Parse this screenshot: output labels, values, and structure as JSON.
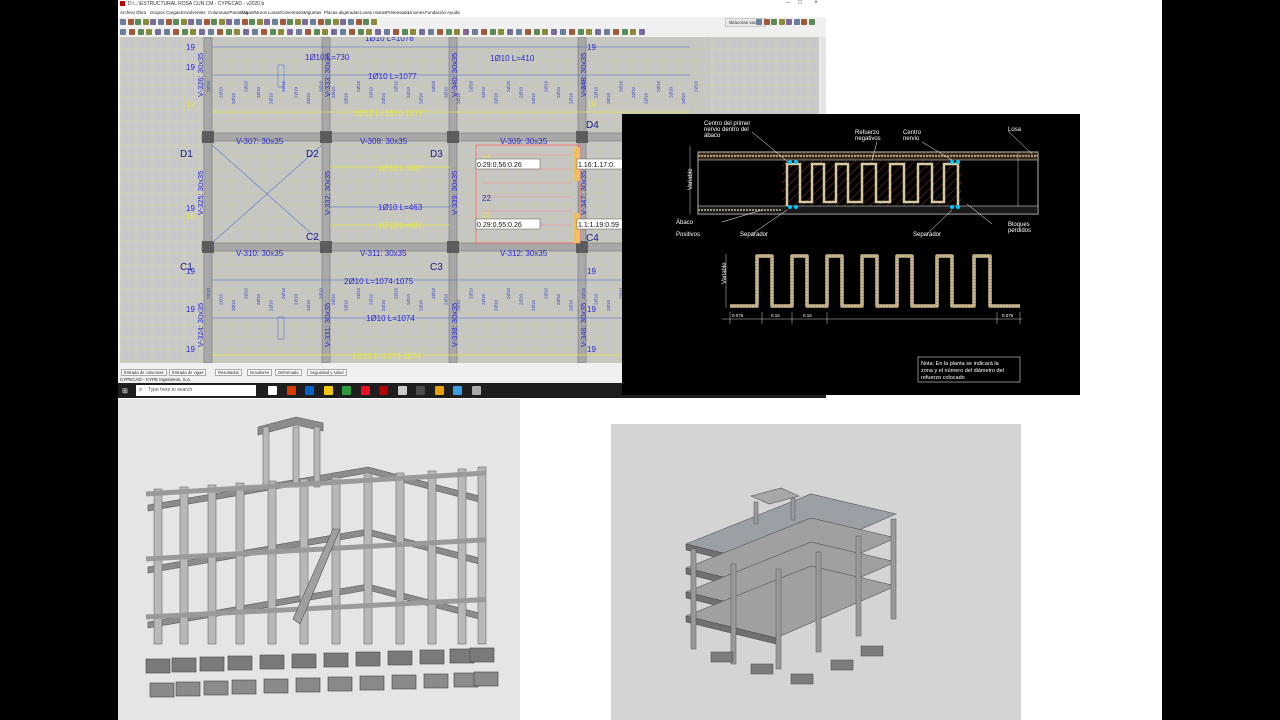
{
  "window": {
    "title": "D:\\...\\ESTRUCTURAL ROSA CUN.CM - CYPECAD - v2020.b",
    "controls": [
      "–",
      "□",
      "×"
    ]
  },
  "menu": [
    "Archivo",
    "Obra",
    "Grupos",
    "Cargas",
    "Envolventes",
    "Columnas/Pantallas",
    "Vigas/Muros",
    "Losas/Cimentados",
    "Viguetas",
    "Placas aligeradas",
    "Losas mixtas",
    "Pretensado",
    "Uniones",
    "Fundación",
    "Ayuda"
  ],
  "toolbar": {
    "badge": "Bitácoras vacias"
  },
  "plan": {
    "beams": [
      {
        "label": "V-307: 30x35"
      },
      {
        "label": "V-308: 30x35"
      },
      {
        "label": "V-309: 30x35"
      },
      {
        "label": "V-310: 30x35"
      },
      {
        "label": "V-311: 30x35"
      },
      {
        "label": "V-312: 30x35"
      }
    ],
    "vbeams": [
      "V-326: 30x35",
      "V-333: 30x35",
      "V-340: 30x35",
      "V-348: 30x35",
      "V-325: 30x35",
      "V-332: 30x35",
      "V-339: 30x35",
      "V-347: 30x35",
      "V-324: 30x35",
      "V-331: 30x35",
      "V-338: 30x35",
      "V-346: 30x35"
    ],
    "nodes": [
      "D1",
      "D2",
      "D3",
      "D4",
      "C1",
      "C2",
      "C3",
      "C4"
    ],
    "rebar_blue": [
      "1Ø10 L=1076",
      "1Ø10 L=730",
      "1Ø10 L=1077",
      "1Ø10 L=410",
      "1Ø10 L=463",
      "2Ø10 L=1074-1075",
      "1Ø10 L=1074"
    ],
    "rebar_yellow": [
      "1Ø12 L=1076-1077",
      "1Ø12 L=407",
      "1Ø12 L=407",
      "1Ø12 L=1073-1074"
    ],
    "side_numbers": [
      "19",
      "19",
      "19",
      "19",
      "19",
      "19",
      "19",
      "19",
      "19",
      "19",
      "19",
      "19",
      "19",
      "19"
    ],
    "stair_numbers": [
      "22",
      "22",
      "22"
    ],
    "values": [
      "0.29:0.56:0.26",
      "1.16:1.17:0.",
      "0.29:0.55:0.26",
      "1.1:1.19:0.59"
    ]
  },
  "tabs": [
    "Entrada de columnas",
    "Entrada de vigas",
    "Resultados",
    "Isovalores",
    "Deformada",
    "Seguridad y salud"
  ],
  "status": "CYPECAD - CYPE Ingenieros, S.A.",
  "taskbar": {
    "search_placeholder": "Type here to search",
    "app_colors": [
      "#ffffff",
      "#d83b01",
      "#0a64c8",
      "#f2c811",
      "#2a9d3a",
      "#e81123",
      "#b00000",
      "#cccccc",
      "#4c4c4c",
      "#e8a000",
      "#3a9de0",
      "#aaaaaa"
    ]
  },
  "cad_detail": {
    "labels": [
      "Centro del primer",
      "nervio dentro del",
      "ábaco",
      "Refuerzo",
      "negativos",
      "Centro",
      "nervio",
      "Losa",
      "Ábaco",
      "Positivos",
      "Separador",
      "Separador",
      "Bloques",
      "perdidos",
      "Variable",
      "Variable"
    ],
    "dims": [
      "0.075",
      "0.15",
      "0.15",
      "0.075"
    ],
    "note": [
      "Nota: En la planta se indicará la",
      "zona y el número del diámetro del",
      "refuerzo colocado"
    ]
  }
}
